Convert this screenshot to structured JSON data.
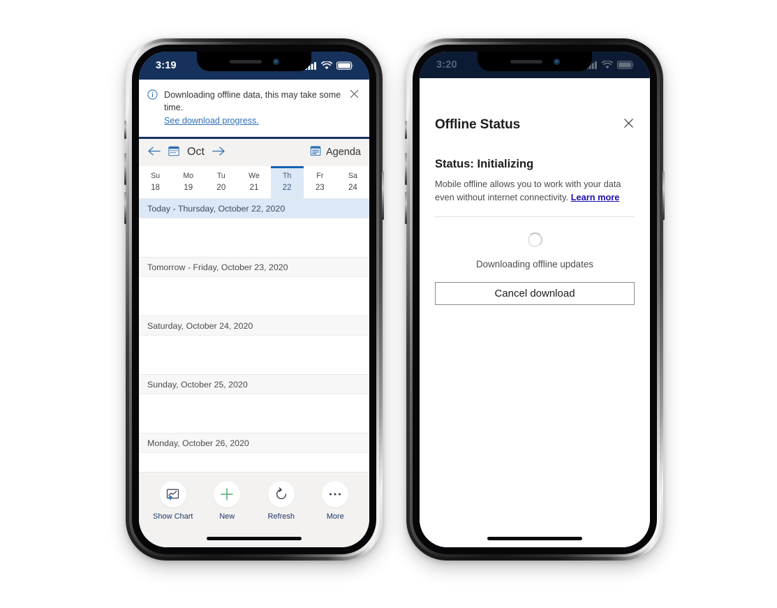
{
  "phones": {
    "left": {
      "statusbar": {
        "time": "3:19",
        "signal_icon": "cellular-signal-icon",
        "wifi_icon": "wifi-icon",
        "battery_icon": "battery-icon"
      },
      "notification": {
        "info_icon": "info-circle-icon",
        "message": "Downloading offline data, this may take some time.",
        "link": "See download progress.",
        "close_icon": "close-icon"
      },
      "calendar_header": {
        "prev_icon": "arrow-left-icon",
        "calendar_icon": "calendar-icon",
        "month": "Oct",
        "next_icon": "arrow-right-icon",
        "agenda_icon": "agenda-view-icon",
        "agenda_label": "Agenda"
      },
      "daystrip": [
        {
          "dow": "Su",
          "num": "18",
          "selected": false
        },
        {
          "dow": "Mo",
          "num": "19",
          "selected": false
        },
        {
          "dow": "Tu",
          "num": "20",
          "selected": false
        },
        {
          "dow": "We",
          "num": "21",
          "selected": false
        },
        {
          "dow": "Th",
          "num": "22",
          "selected": true
        },
        {
          "dow": "Fr",
          "num": "23",
          "selected": false
        },
        {
          "dow": "Sa",
          "num": "24",
          "selected": false
        }
      ],
      "agenda_rows": [
        {
          "label": "Today - Thursday, October 22, 2020",
          "today": true
        },
        {
          "label": "Tomorrow - Friday, October 23, 2020",
          "today": false
        },
        {
          "label": "Saturday, October 24, 2020",
          "today": false
        },
        {
          "label": "Sunday, October 25, 2020",
          "today": false
        },
        {
          "label": "Monday, October 26, 2020",
          "today": false
        }
      ],
      "toolbar": [
        {
          "label": "Show Chart",
          "icon": "show-chart-icon"
        },
        {
          "label": "New",
          "icon": "plus-icon"
        },
        {
          "label": "Refresh",
          "icon": "refresh-icon"
        },
        {
          "label": "More",
          "icon": "ellipsis-icon"
        }
      ]
    },
    "right": {
      "statusbar": {
        "time": "3:20",
        "signal_icon": "cellular-signal-icon",
        "wifi_icon": "wifi-icon",
        "battery_icon": "battery-icon"
      },
      "modal": {
        "title": "Offline Status",
        "close_icon": "close-icon",
        "status": "Status: Initializing",
        "description": "Mobile offline allows you to work with your data even without internet connectivity.",
        "learn_more": "Learn more",
        "spinner_icon": "loading-spinner-icon",
        "downloading_text": "Downloading offline updates",
        "cancel_label": "Cancel download"
      }
    }
  },
  "colors": {
    "status_bar": "#16325c",
    "accent_blue": "#2f6fb5",
    "selected_day_bg": "#dce8f6",
    "selected_day_bar": "#1462b5",
    "toolbar_bg": "#f3f2f1",
    "link": "#1a0dab",
    "new_green": "#4caf6e"
  }
}
